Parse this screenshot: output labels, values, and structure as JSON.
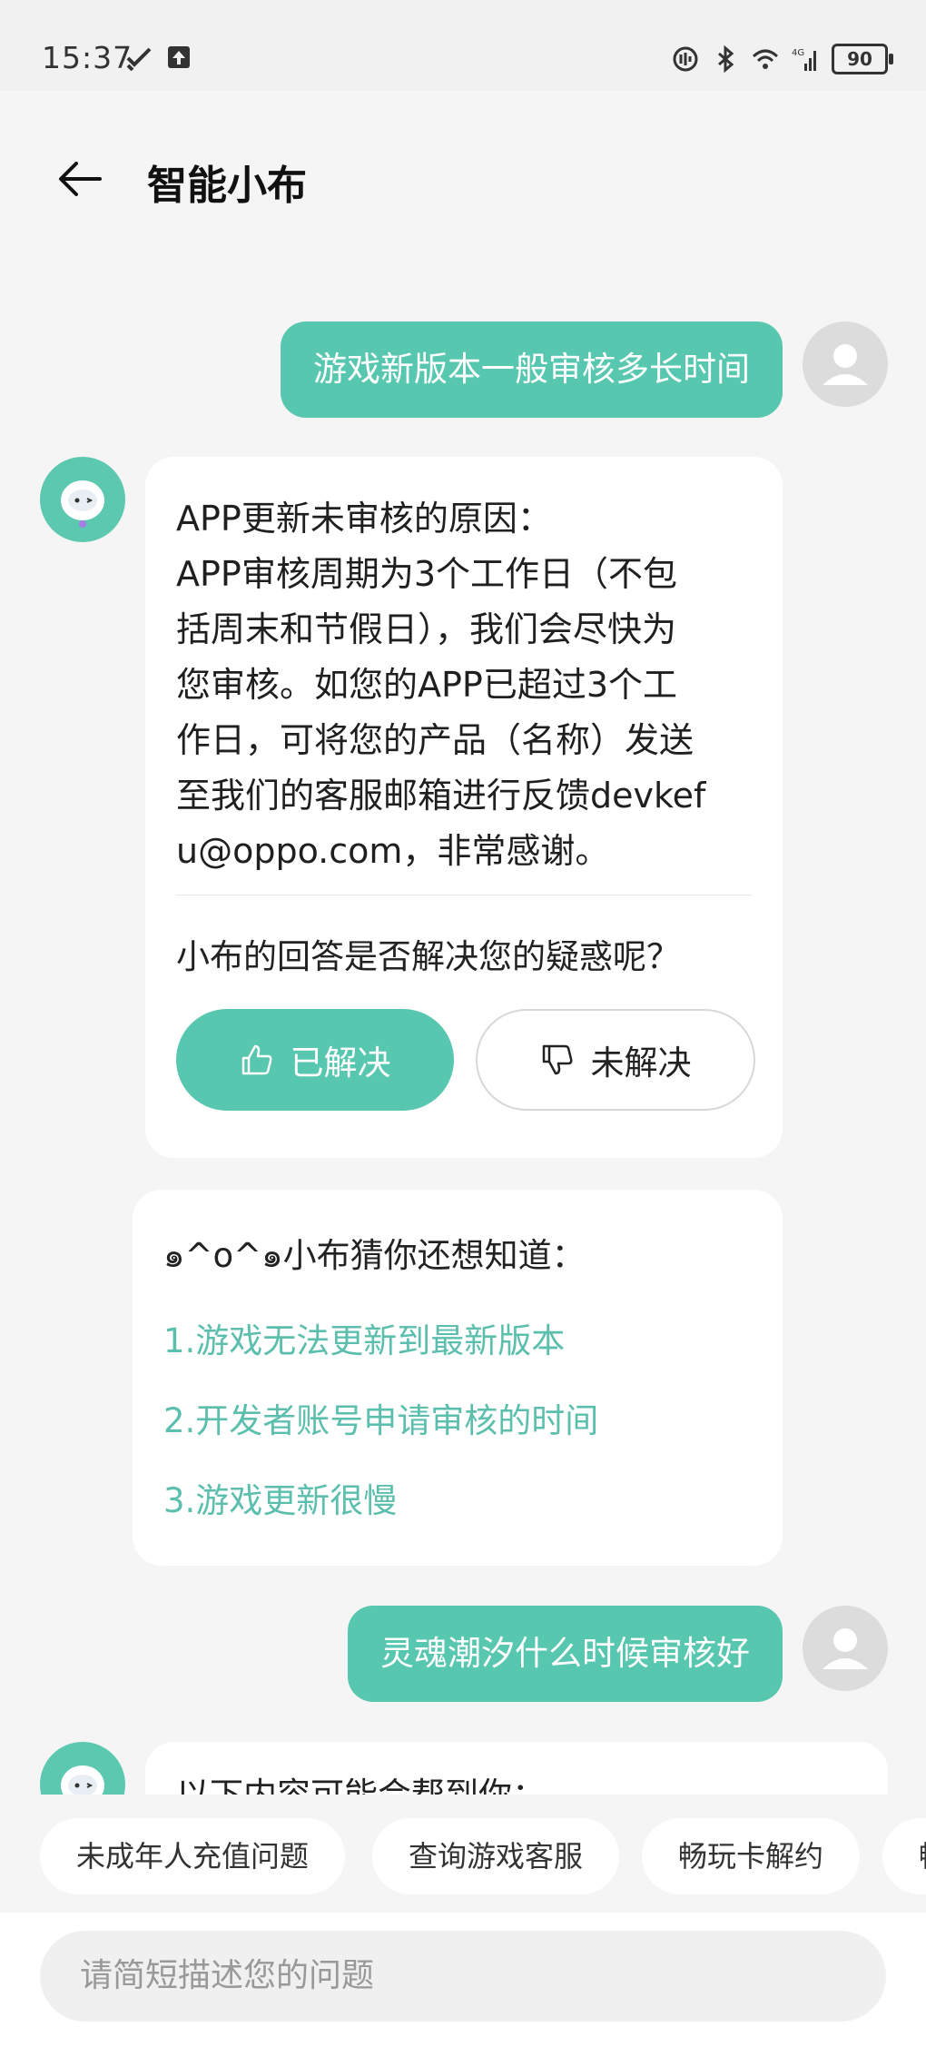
{
  "status": {
    "time": "15:37",
    "battery": "90",
    "network": "4G"
  },
  "header": {
    "title": "智能小布"
  },
  "messages": {
    "user1": "游戏新版本一般审核多长时间",
    "answer_lines": [
      "APP更新未审核的原因：",
      "APP审核周期为3个工作日（不包",
      "括周末和节假日），我们会尽快为",
      "您审核。如您的APP已超过3个工",
      "作日，可将您的产品（名称）发送",
      "至我们的客服邮箱进行反馈devkef",
      "u@oppo.com，非常感谢。"
    ],
    "feedback_question": "小布的回答是否解决您的疑惑呢？",
    "solved_label": "已解决",
    "unsolved_label": "未解决",
    "suggest_title": "๑^o^๑小布猜你还想知道：",
    "suggestions": [
      "1.游戏无法更新到最新版本",
      "2.开发者账号申请审核的时间",
      "3.游戏更新很慢"
    ],
    "user2": "灵魂潮汐什么时候审核好",
    "partial_answer": "以下内容可能会帮到你："
  },
  "quick_replies": [
    "未成年人充值问题",
    "查询游戏客服",
    "畅玩卡解约",
    "畅"
  ],
  "input": {
    "placeholder": "请简短描述您的问题"
  },
  "colors": {
    "accent": "#58c7b0",
    "link": "#5cbfae",
    "background": "#f5f5f5"
  }
}
